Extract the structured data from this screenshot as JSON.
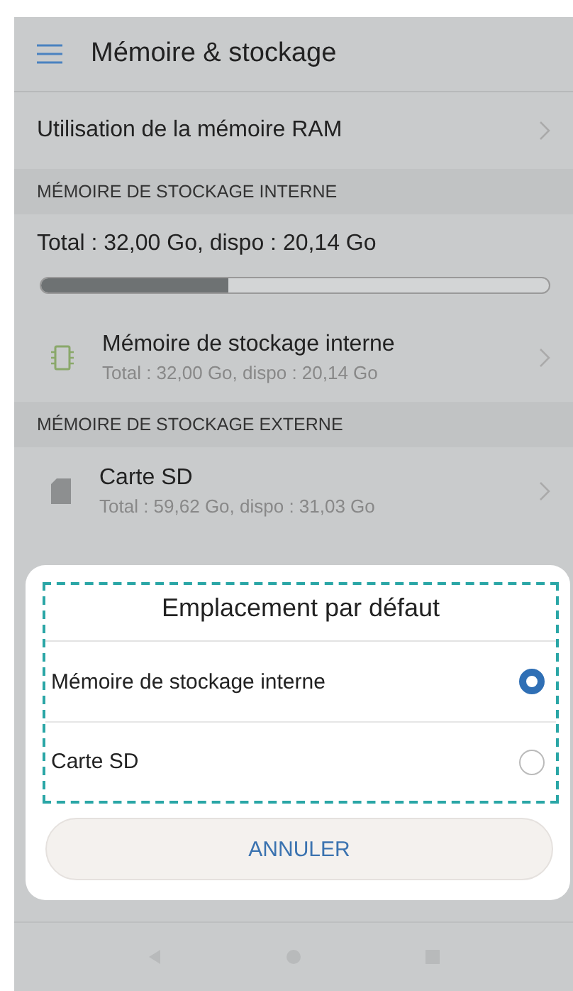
{
  "header": {
    "title": "Mémoire & stockage"
  },
  "ram_row": {
    "label": "Utilisation de la mémoire RAM"
  },
  "internal_section": {
    "heading": "MÉMOIRE DE STOCKAGE INTERNE",
    "summary": "Total : 32,00  Go, dispo : 20,14  Go",
    "level": 0.37
  },
  "storage_items": [
    {
      "kind": "chip",
      "title": "Mémoire de stockage interne",
      "subtitle": "Total : 32,00  Go, dispo : 20,14  Go"
    },
    {
      "kind": "heading",
      "title": "MÉMOIRE DE STOCKAGE EXTERNE"
    },
    {
      "kind": "sdcard",
      "title": "Carte SD",
      "subtitle": "Total : 59,62  Go, dispo : 31,03  Go"
    }
  ],
  "dialog": {
    "title": "Emplacement par défaut",
    "options": [
      {
        "label": "Mémoire de stockage interne",
        "selected": true
      },
      {
        "label": "Carte SD",
        "selected": false
      }
    ],
    "cancel": "ANNULER"
  }
}
